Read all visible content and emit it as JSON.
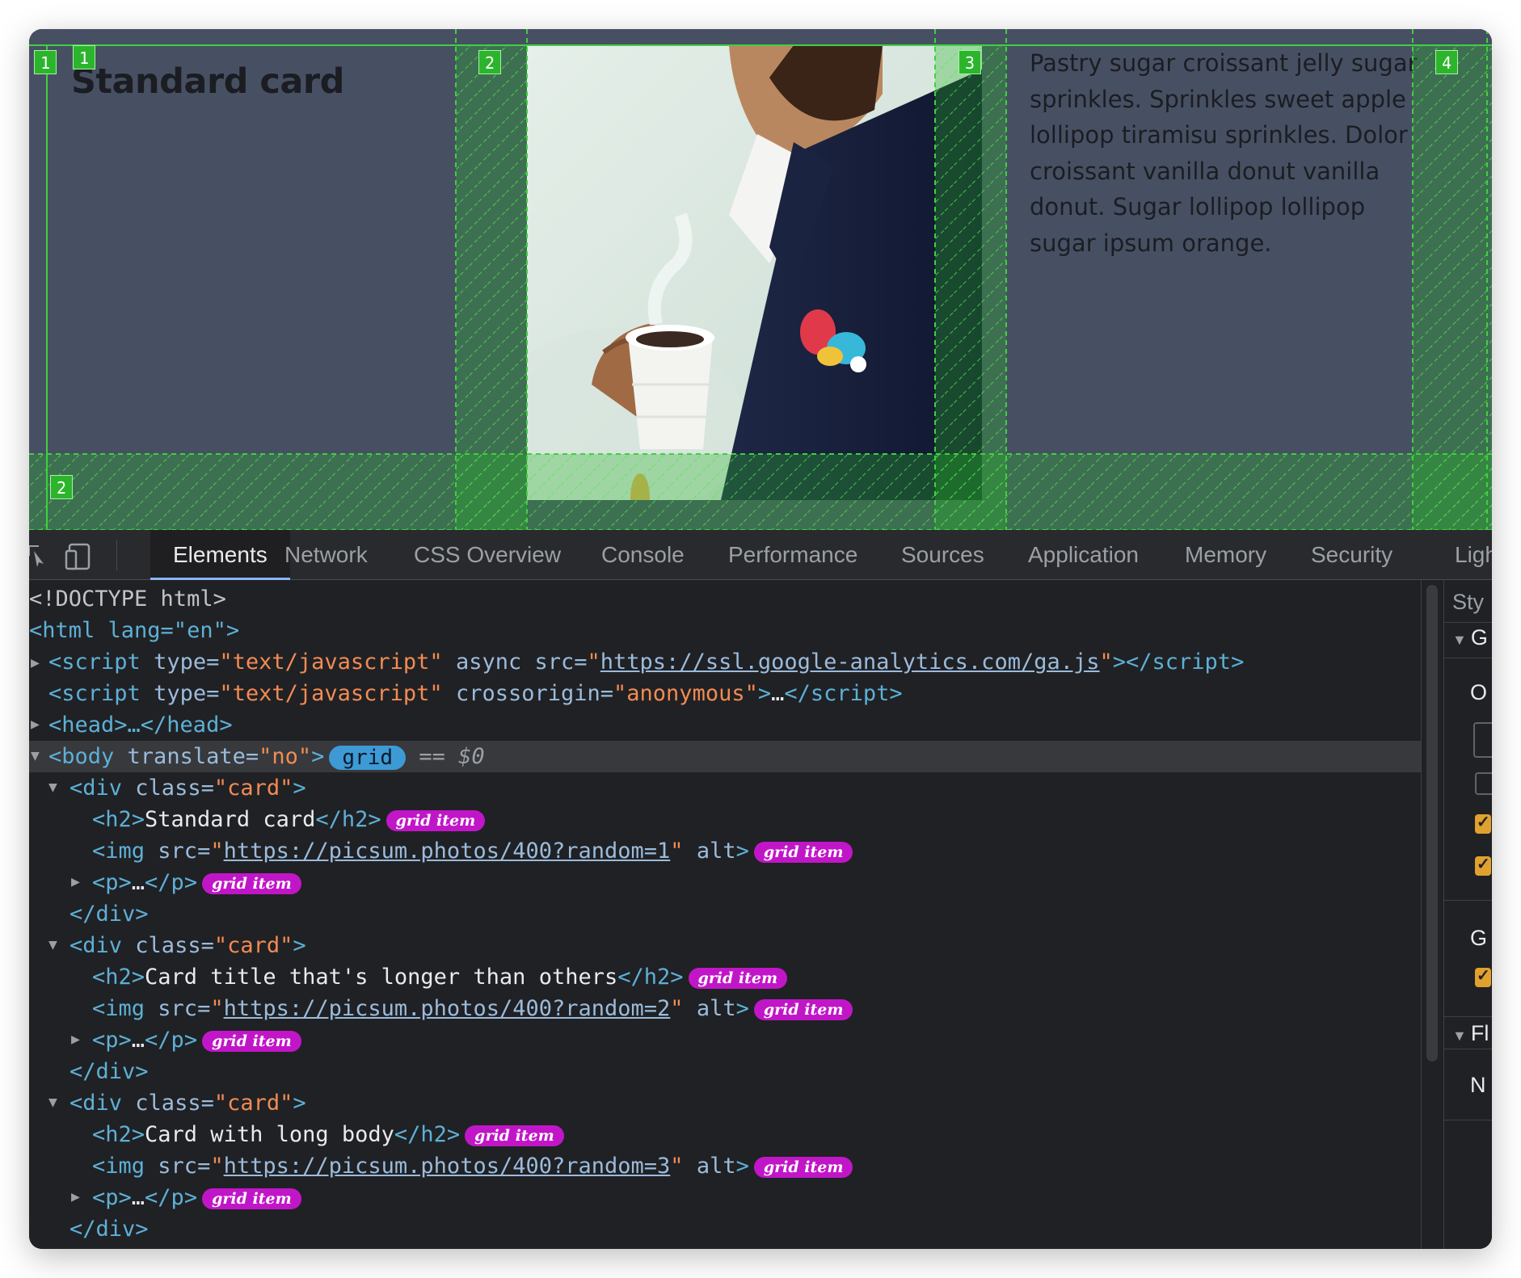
{
  "viewport": {
    "card_title": "Standard card",
    "card_text": "Pastry sugar croissant jelly sugar sprinkles. Sprinkles sweet apple lollipop tiramisu sprinkles. Dolor croissant vanilla donut vanilla donut. Sugar lollipop lollipop sugar ipsum orange.",
    "grid_badges": {
      "col1": "1",
      "row1": "1",
      "col2": "2",
      "col3": "3",
      "col4": "4",
      "row2": "2"
    }
  },
  "devtools": {
    "tabs": [
      "Elements",
      "Network",
      "CSS Overview",
      "Console",
      "Performance",
      "Sources",
      "Application",
      "Memory",
      "Security",
      "Ligh"
    ],
    "active_tab": "Elements",
    "dom": {
      "doctype": "<!DOCTYPE html>",
      "html_open": "<html lang=\"en\">",
      "ga_script_src": "https://ssl.google-analytics.com/ga.js",
      "head": "<head>…</head>",
      "body_translate": "no",
      "body_badge": "grid",
      "selected_marker": "== $0",
      "cards": [
        {
          "h2": "Standard card",
          "img_src": "https://picsum.photos/400?random=1"
        },
        {
          "h2": "Card title that's longer than others",
          "img_src": "https://picsum.photos/400?random=2"
        },
        {
          "h2": "Card with long body",
          "img_src": "https://picsum.photos/400?random=3"
        }
      ],
      "grid_item_badge": "grid item"
    },
    "styles_panel": {
      "title": "Sty",
      "section_g": "G",
      "row_o": "O",
      "row_g": "G",
      "section_f": "Fl",
      "row_n": "N"
    }
  },
  "colors": {
    "viewport_bg": "#475063",
    "grid_overlay": "#2cb52c",
    "devtools_bg": "#202124",
    "tag_color": "#5db0d7",
    "attr_value_color": "#f28b54",
    "grid_badge_pill": "#3d9ad5",
    "grid_item_pill": "#c116c8",
    "checkbox_orange": "#e0a12e"
  }
}
